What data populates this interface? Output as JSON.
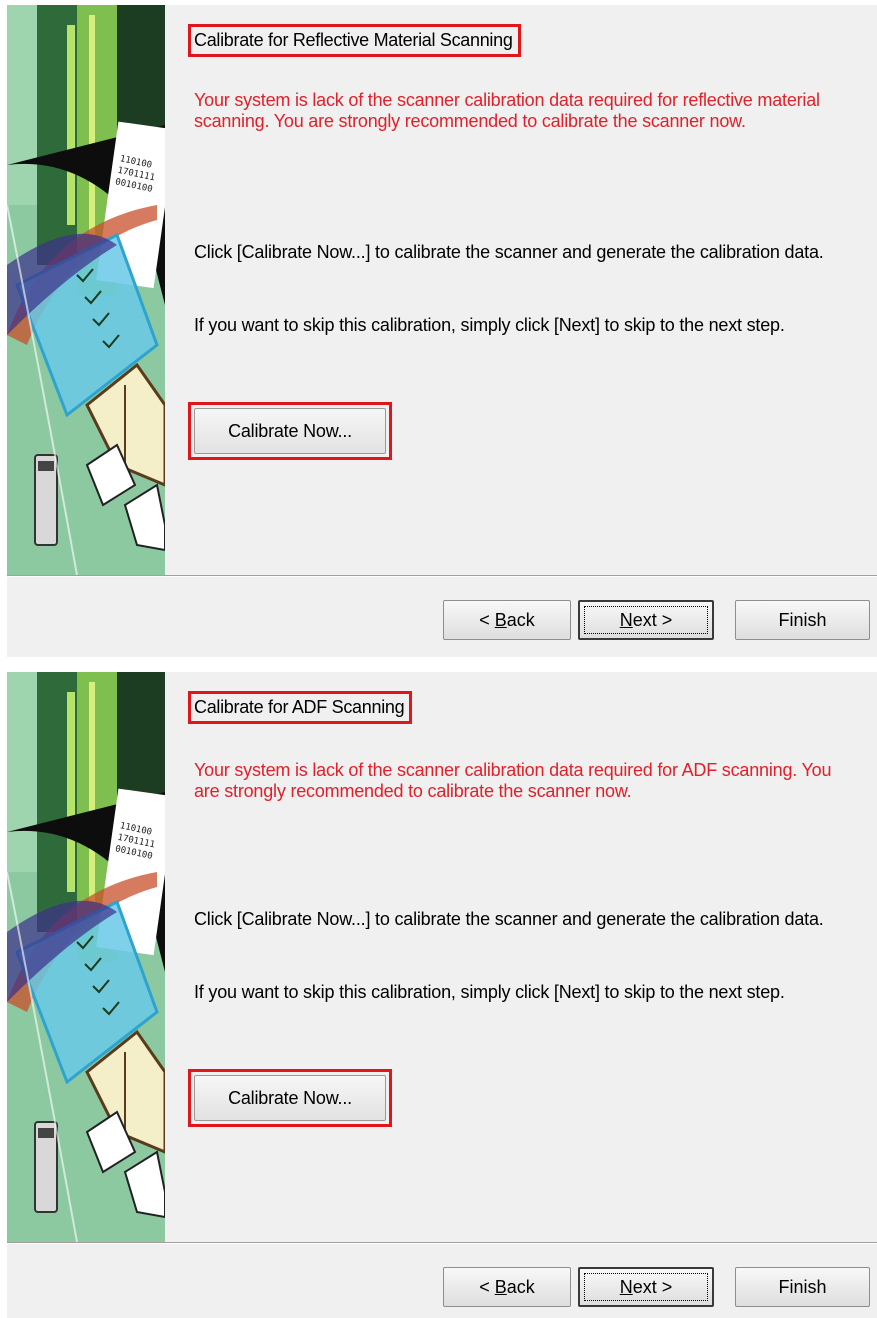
{
  "dialogs": [
    {
      "title": "Calibrate for Reflective Material Scanning",
      "warning": "Your system is lack of the scanner calibration data required for reflective material scanning.  You are strongly recommended to calibrate the scanner now.",
      "instruction": "Click [Calibrate Now...] to calibrate the scanner and generate the calibration data.",
      "skip": "If you want to skip this calibration, simply click [Next] to skip to the next step.",
      "calibrate_label": "Calibrate Now...",
      "back_prefix": "< ",
      "back_mnemonic": "B",
      "back_rest": "ack",
      "next_mnemonic": "N",
      "next_rest": "ext >",
      "finish_label": "Finish"
    },
    {
      "title": "Calibrate for ADF Scanning",
      "warning": "Your system is lack of the scanner calibration data required for ADF scanning.  You are strongly recommended to calibrate the scanner now.",
      "instruction": "Click [Calibrate Now...] to calibrate the scanner and generate the calibration data.",
      "skip": "If you want to skip this calibration, simply click [Next] to skip to the next step.",
      "calibrate_label": "Calibrate Now...",
      "back_prefix": "< ",
      "back_mnemonic": "B",
      "back_rest": "ack",
      "next_mnemonic": "N",
      "next_rest": "ext >",
      "finish_label": "Finish"
    }
  ],
  "colors": {
    "highlight": "#e0161b",
    "warning_text": "#e0202a",
    "dialog_bg": "#f0f0f0"
  }
}
